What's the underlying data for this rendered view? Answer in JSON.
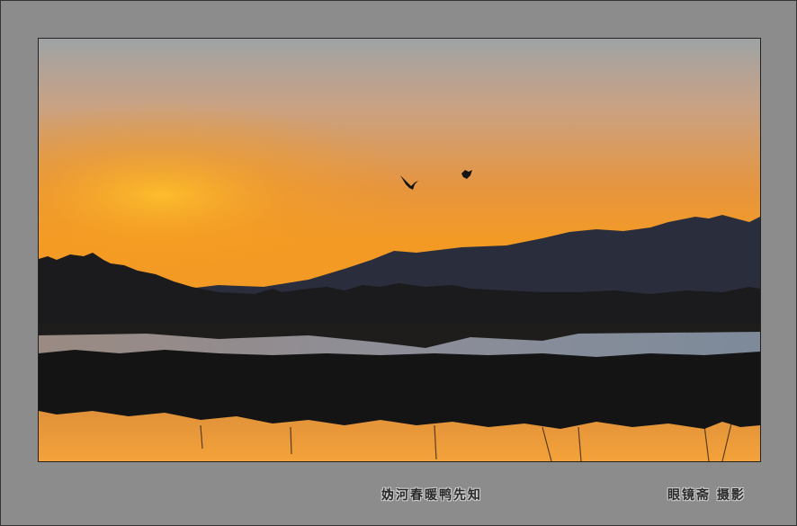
{
  "caption": {
    "title": "妫河春暖鸭先知",
    "credit": "眼镜斋  摄影"
  },
  "colors": {
    "frame": "#8c8c8c",
    "sky_top": "#9aa0a3",
    "sky_mid": "#e79a45",
    "sun_glow": "#f7a51f",
    "mountains": "#2b2f3d",
    "water_reflection": "#e59a3c"
  }
}
